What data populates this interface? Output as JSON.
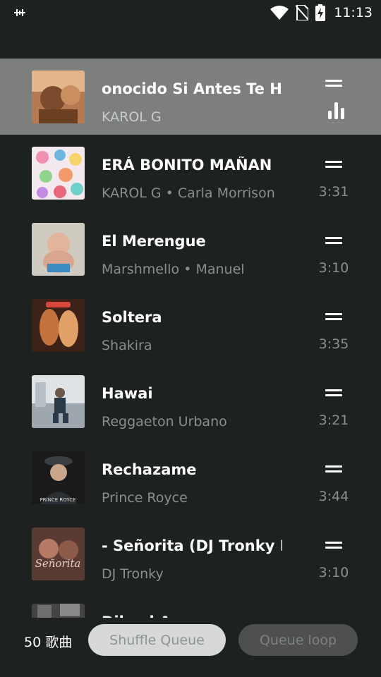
{
  "status_bar": {
    "time": "11:13"
  },
  "queue": [
    {
      "title": "Si Antes Te Hubiera Conocido",
      "title_display": "onocido     Si Antes Te H",
      "subtitle": "KAROL G",
      "duration": "",
      "current": true,
      "art_colors": [
        "#d6a87a",
        "#7a4b2c",
        "#e8c9a0"
      ]
    },
    {
      "title": "MAÑANA SERÁ BONITO",
      "title_display": "ERÁ BONITO     MAÑAN",
      "subtitle": "KAROL G • Carla Morrison",
      "duration": "3:31",
      "current": false,
      "art_colors": [
        "#f4c7d6",
        "#6fb7e0",
        "#f7d46b"
      ]
    },
    {
      "title": "El Merengue",
      "title_display": "El Merengue",
      "subtitle": "Marshmello • Manuel",
      "duration": "3:10",
      "current": false,
      "art_colors": [
        "#c7c4b8",
        "#d9a58e",
        "#3b8bc3"
      ]
    },
    {
      "title": "Soltera",
      "title_display": "Soltera",
      "subtitle": "Shakira",
      "duration": "3:35",
      "current": false,
      "art_colors": [
        "#3d2218",
        "#c4733f",
        "#e0a066"
      ]
    },
    {
      "title": "Hawai",
      "title_display": "Hawai",
      "subtitle": "Reggaeton Urbano",
      "duration": "3:21",
      "current": false,
      "art_colors": [
        "#dfe3e6",
        "#9da7ad",
        "#2b3a48"
      ]
    },
    {
      "title": "Rechazame",
      "title_display": "Rechazame",
      "subtitle": "Prince Royce",
      "duration": "3:44",
      "current": false,
      "art_colors": [
        "#1a1a1a",
        "#3a3f44",
        "#c9a58a"
      ],
      "art_caption": "PRINCE ROYCE"
    },
    {
      "title": "Señorita (DJ Tronky Bootleg)",
      "title_display": "- Señorita (DJ Tronky B",
      "subtitle": "DJ Tronky",
      "duration": "3:10",
      "current": false,
      "art_colors": [
        "#5a3b33",
        "#b67a64",
        "#e6d0c3"
      ],
      "art_caption": "Señorita"
    },
    {
      "title": "Dile al Amor",
      "title_display": "Dile al Amor",
      "subtitle": "",
      "duration": "",
      "current": false,
      "art_colors": [
        "#222",
        "#555",
        "#888"
      ]
    }
  ],
  "footer": {
    "count_label": "50 歌曲",
    "shuffle_label": "Shuffle Queue",
    "loop_label": "Queue loop"
  }
}
